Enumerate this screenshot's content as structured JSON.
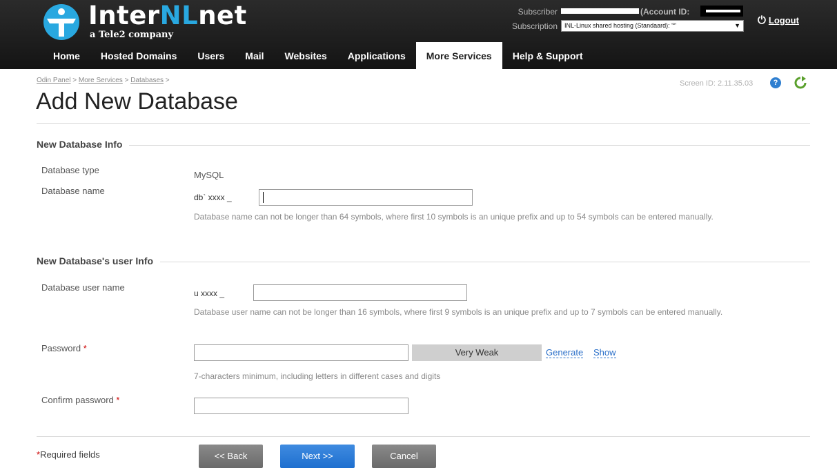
{
  "header": {
    "logo_prefix": "Inter",
    "logo_accent": "NL",
    "logo_suffix": "net",
    "logo_tagline": "a Tele2 company",
    "subscriber_label": "Subscriber",
    "account_label": "(Account ID:",
    "subscription_label": "Subscription",
    "subscription_value": "INL-Linux shared hosting (Standaard): '°'",
    "logout_label": "Logout",
    "colors": {
      "accent": "#29a8e0",
      "bar": "#1c1c1c",
      "link": "#2a6fc9",
      "button_blue": "#1e6fcf",
      "button_gray": "#777777"
    }
  },
  "nav": {
    "items": [
      {
        "label": "Home",
        "active": false
      },
      {
        "label": "Hosted Domains",
        "active": false
      },
      {
        "label": "Users",
        "active": false
      },
      {
        "label": "Mail",
        "active": false
      },
      {
        "label": "Websites",
        "active": false
      },
      {
        "label": "Applications",
        "active": false
      },
      {
        "label": "More Services",
        "active": true
      },
      {
        "label": "Help & Support",
        "active": false
      }
    ]
  },
  "breadcrumb": {
    "items": [
      "Odin Panel",
      "More Services",
      "Databases"
    ],
    "separator": ">"
  },
  "screen_id": "Screen ID:  2.11.35.03",
  "icons": {
    "help": "help-circle-icon",
    "refresh": "refresh-icon",
    "logout": "power-icon"
  },
  "page_title": "Add New Database",
  "section_db": {
    "title": "New Database Info",
    "type_label": "Database type",
    "type_value": "MySQL",
    "name_label": "Database name",
    "name_prefix": "db` xxxx   _",
    "name_value": "",
    "name_hint": "Database name can not be longer than 64 symbols, where first 10 symbols is an unique prefix and up to 54 symbols can be entered manually."
  },
  "section_user": {
    "title": "New Database's user Info",
    "user_label": "Database user name",
    "user_prefix": "u  xxxx    _",
    "user_value": "",
    "user_hint": "Database user name can not be longer than 16 symbols, where first 9 symbols is an unique prefix and up to 7 symbols can be entered manually.",
    "password_label": "Password",
    "password_value": "",
    "strength_label": "Very Weak",
    "generate_label": "Generate",
    "show_label": "Show",
    "password_hint": "7-characters minimum, including letters in different cases and digits",
    "confirm_label": "Confirm password",
    "confirm_value": "",
    "required_mark": "*"
  },
  "footer": {
    "required_mark": "*",
    "required_note": "Required fields",
    "back_label": "<< Back",
    "next_label": "Next >>",
    "cancel_label": "Cancel"
  }
}
